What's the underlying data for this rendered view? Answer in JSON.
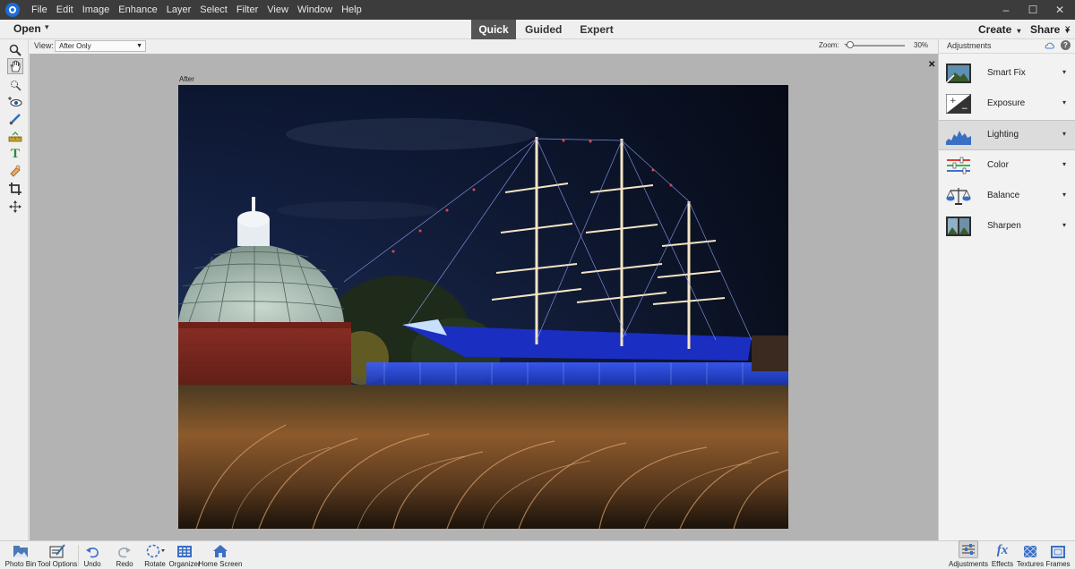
{
  "menu": {
    "items": [
      "File",
      "Edit",
      "Image",
      "Enhance",
      "Layer",
      "Select",
      "Filter",
      "View",
      "Window",
      "Help"
    ],
    "window_controls": [
      "–",
      "☐",
      "✕"
    ]
  },
  "topbar": {
    "open_label": "Open",
    "open_caret": "▾",
    "modes": [
      "Quick",
      "Guided",
      "Expert"
    ],
    "active_mode": "Quick",
    "create_label": "Create",
    "share_label": "Share",
    "caret": "▾"
  },
  "options": {
    "view_label": "View:",
    "view_value": "After Only",
    "zoom_label": "Zoom:",
    "zoom_value": "30%",
    "zoom_minus": "−"
  },
  "canvas": {
    "after_label": "After",
    "close_glyph": "✕"
  },
  "tools": [
    "zoom-tool",
    "hand-tool",
    "quick-selection-tool",
    "red-eye-tool",
    "whiten-teeth-tool",
    "straighten-tool",
    "text-tool",
    "spot-healing-tool",
    "crop-tool",
    "move-tool"
  ],
  "adjustments": {
    "title": "Adjustments",
    "close_glyph": "✕",
    "help_glyph": "?",
    "items": [
      {
        "label": "Smart Fix",
        "icon": "smart-fix-icon",
        "active": false
      },
      {
        "label": "Exposure",
        "icon": "exposure-icon",
        "active": false
      },
      {
        "label": "Lighting",
        "icon": "lighting-icon",
        "active": true
      },
      {
        "label": "Color",
        "icon": "color-icon",
        "active": false
      },
      {
        "label": "Balance",
        "icon": "balance-icon",
        "active": false
      },
      {
        "label": "Sharpen",
        "icon": "sharpen-icon",
        "active": false
      }
    ],
    "caret": "▾"
  },
  "bottom": {
    "left": [
      {
        "label": "Photo Bin",
        "icon": "photo-bin-icon"
      },
      {
        "label": "Tool Options",
        "icon": "tool-options-icon"
      },
      {
        "label": "Undo",
        "icon": "undo-icon"
      },
      {
        "label": "Redo",
        "icon": "redo-icon"
      },
      {
        "label": "Rotate",
        "icon": "rotate-icon"
      },
      {
        "label": "Organizer",
        "icon": "organizer-icon"
      },
      {
        "label": "Home Screen",
        "icon": "home-icon"
      }
    ],
    "right": [
      {
        "label": "Adjustments",
        "icon": "adjustments-icon"
      },
      {
        "label": "Effects",
        "icon": "effects-icon"
      },
      {
        "label": "Textures",
        "icon": "textures-icon"
      },
      {
        "label": "Frames",
        "icon": "frames-icon"
      }
    ]
  },
  "colors": {
    "menubar": "#3c3c3c",
    "active_tab": "#555555",
    "canvas_bg": "#b3b3b3",
    "accent_blue": "#1c6ed6"
  }
}
